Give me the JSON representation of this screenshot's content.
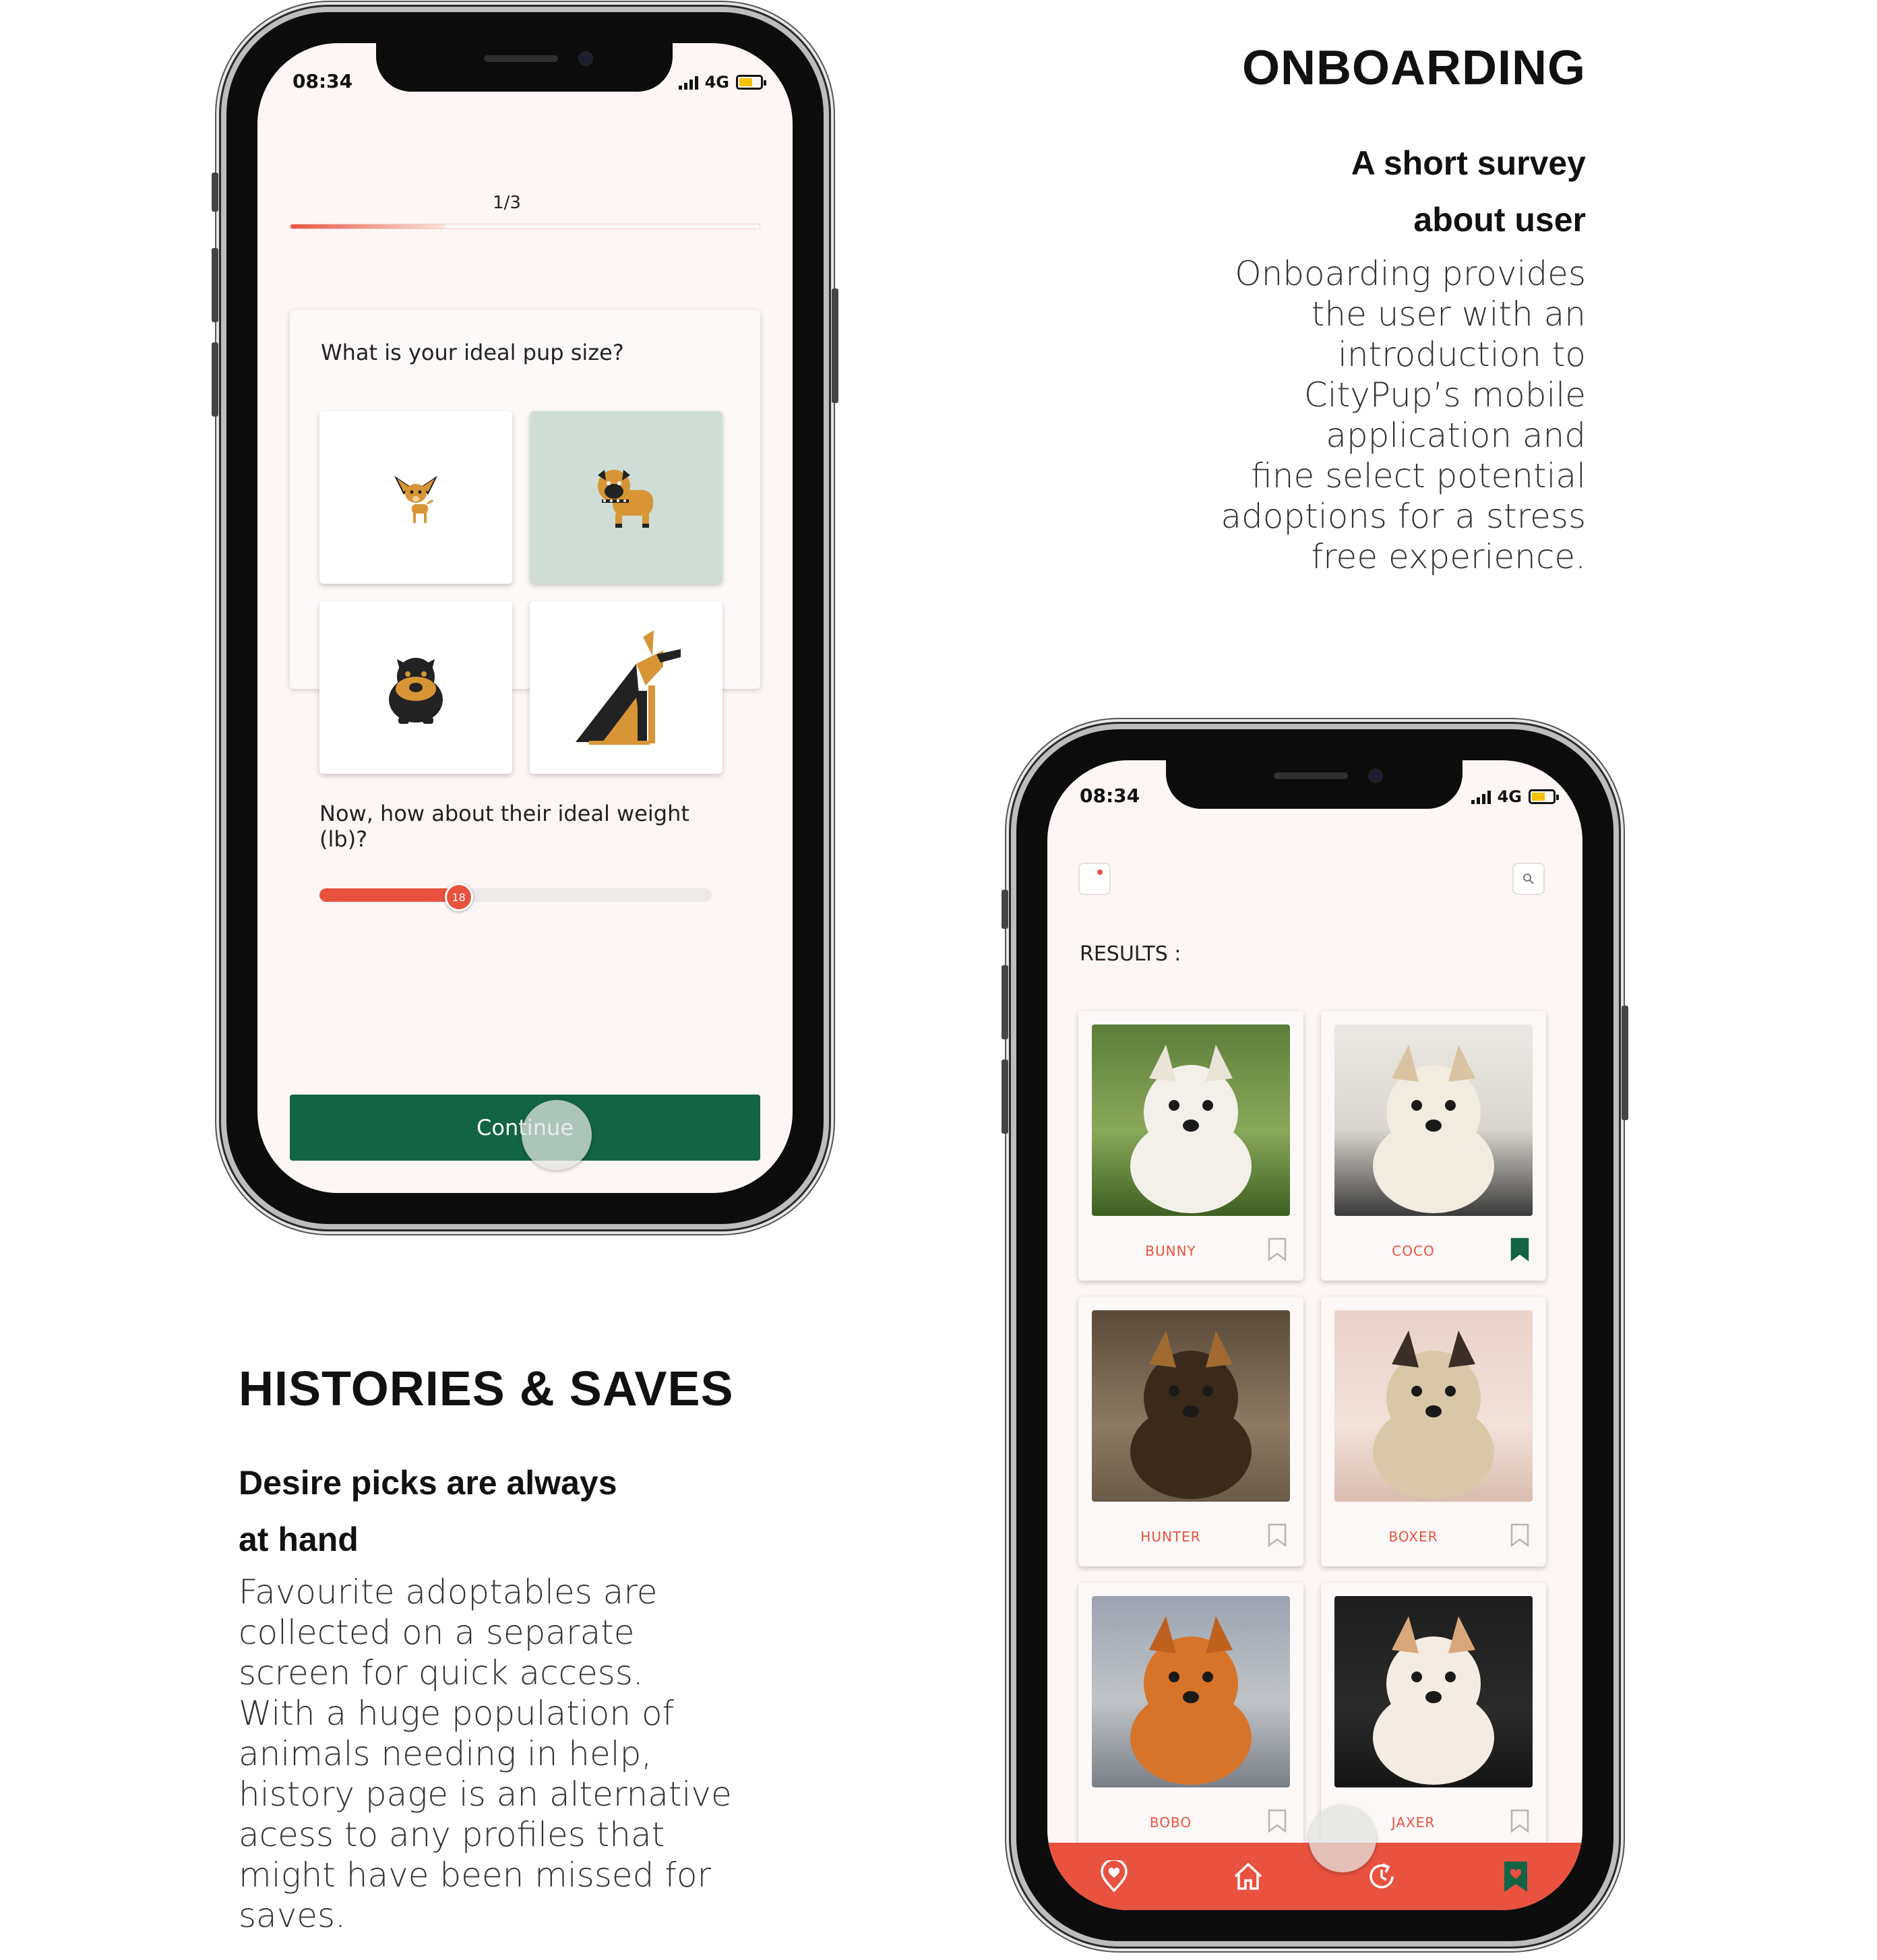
{
  "onboarding": {
    "heading": "ONBOARDING",
    "subheading_line1": "A short survey",
    "subheading_line2": "about user",
    "body_lines": [
      "Onboarding provides",
      "the user with an",
      "introduction to",
      "CityPup’s mobile",
      "application and",
      "fine select potential",
      "adoptions for a stress",
      "free experience."
    ]
  },
  "histories": {
    "heading": "HISTORIES & SAVES",
    "subheading_line1": "Desire picks are always",
    "subheading_line2": "at hand",
    "body_lines": [
      "Favourite adoptables are",
      "collected on a separate",
      "screen for quick access.",
      "With a huge population of",
      "animals needing in help,",
      "history page is an alternative",
      "acess to any profiles that",
      "might have been missed for",
      "saves."
    ]
  },
  "status_bar": {
    "time": "08:34",
    "network": "4G"
  },
  "survey": {
    "progress_label": "1/3",
    "progress_fraction": 0.33,
    "question_size": "What is your ideal pup size?",
    "size_options": [
      {
        "name": "chihuahua-icon",
        "selected": false
      },
      {
        "name": "pug-icon",
        "selected": true
      },
      {
        "name": "bulldog-icon",
        "selected": false
      },
      {
        "name": "doberman-icon",
        "selected": false
      }
    ],
    "question_weight": "Now, how about their ideal weight (lb)?",
    "weight_value": "18",
    "weight_fraction": 0.35,
    "continue_label": "Continue"
  },
  "results": {
    "label": "RESULTS :",
    "pets": [
      {
        "name": "BUNNY",
        "saved": false
      },
      {
        "name": "COCO",
        "saved": true
      },
      {
        "name": "HUNTER",
        "saved": false
      },
      {
        "name": "BOXER",
        "saved": false
      },
      {
        "name": "BOBO",
        "saved": false
      },
      {
        "name": "JAXER",
        "saved": false
      }
    ],
    "nav_items": [
      "heart-location-icon",
      "home-icon",
      "history-icon",
      "saved-bookmark-icon"
    ]
  },
  "colors": {
    "accent": "#e8523f",
    "primary_green": "#126444",
    "background": "#fdf6f4",
    "selected_tile": "#cfddd6"
  }
}
